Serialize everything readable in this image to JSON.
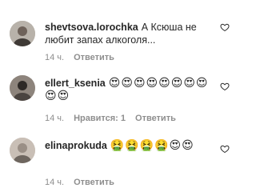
{
  "comments": [
    {
      "username": "shevtsova.lorochka",
      "text": "А Ксюша не любит запах алкоголя...",
      "time": "14 ч.",
      "likes": "",
      "reply": "Ответить",
      "avatar_color": "#b8b2aa",
      "icon": "heart-icon"
    },
    {
      "username": "ellert_ksenia",
      "text": "😍😍😍😍😍😍😍😍😍😍",
      "time": "14 ч.",
      "likes": "Нравится: 1",
      "reply": "Ответить",
      "avatar_color": "#4a4440",
      "icon": "heart-icon"
    },
    {
      "username": "elinaprokuda",
      "text": "🤮🤮🤮🤮😍😍",
      "time": "14 ч.",
      "likes": "",
      "reply": "Ответить",
      "avatar_color": "#9a8f86",
      "icon": "heart-icon"
    }
  ]
}
